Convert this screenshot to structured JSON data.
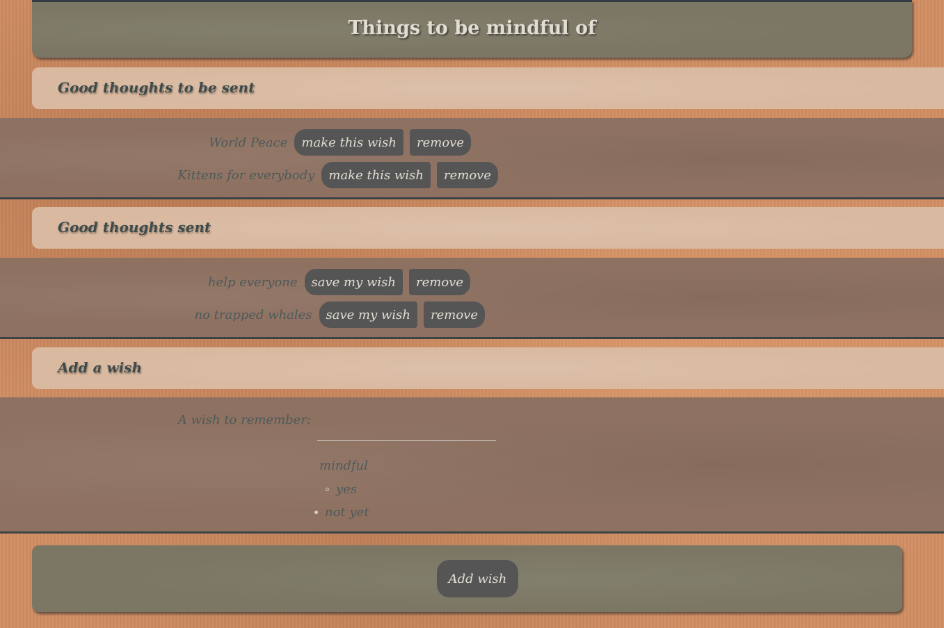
{
  "header": {
    "title": "Things to be mindful of"
  },
  "pending": {
    "heading": "Good thoughts to be sent",
    "items": [
      {
        "label": "World Peace",
        "action_label": "make this wish",
        "remove_label": "remove"
      },
      {
        "label": "Kittens for everybody",
        "action_label": "make this wish",
        "remove_label": "remove"
      }
    ]
  },
  "sent": {
    "heading": "Good thoughts sent",
    "items": [
      {
        "label": "help everyone",
        "action_label": "save my wish",
        "remove_label": "remove"
      },
      {
        "label": "no trapped whales",
        "action_label": "save my wish",
        "remove_label": "remove"
      }
    ]
  },
  "add": {
    "heading": "Add a wish",
    "wish_label": "A wish to remember:",
    "wish_value": "",
    "mindful_label": "mindful",
    "options": [
      {
        "label": "yes",
        "selected": false
      },
      {
        "label": "not yet",
        "selected": true
      }
    ]
  },
  "footer": {
    "submit_label": "Add wish"
  }
}
